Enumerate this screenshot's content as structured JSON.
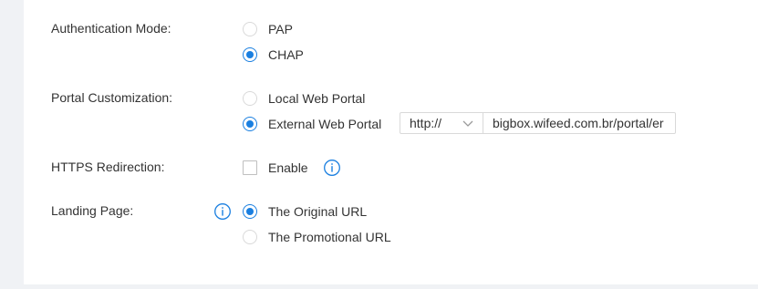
{
  "colors": {
    "accent": "#1a7fe0",
    "page_background": "#f0f2f5",
    "panel_background": "#ffffff",
    "text": "#333333",
    "border": "#d9d9d9"
  },
  "auth_mode": {
    "label": "Authentication Mode:",
    "options": [
      {
        "label": "PAP",
        "checked": false
      },
      {
        "label": "CHAP",
        "checked": true
      }
    ]
  },
  "portal_customization": {
    "label": "Portal Customization:",
    "options": [
      {
        "label": "Local Web Portal",
        "checked": false
      },
      {
        "label": "External Web Portal",
        "checked": true
      }
    ],
    "protocol_select": {
      "value": "http://",
      "icon": "chevron-down-icon"
    },
    "url_input": {
      "value": "bigbox.wifeed.com.br/portal/er"
    }
  },
  "https_redirection": {
    "label": "HTTPS Redirection:",
    "checkbox_label": "Enable",
    "checked": false,
    "info_icon": "info-icon"
  },
  "landing_page": {
    "label": "Landing Page:",
    "info_icon": "info-icon",
    "options": [
      {
        "label": "The Original URL",
        "checked": true
      },
      {
        "label": "The Promotional URL",
        "checked": false
      }
    ]
  }
}
